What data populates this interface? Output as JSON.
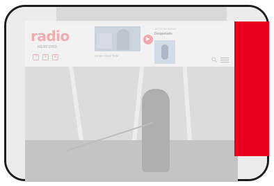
{
  "brand": {
    "logo_text": "radio",
    "logo_sub": "HERFORD"
  },
  "header": {
    "now_playing_label": "JETZT IM RADIO",
    "now_playing_title": "Desperado",
    "caption": "ca ab  Olivat Telte",
    "mini_icons": [
      "?",
      "X",
      "8"
    ]
  },
  "colors": {
    "accent_red": "#e8001c",
    "frame": "#1d1d1d",
    "logo_pink": "#f0a7ad"
  },
  "icons": {
    "search": "search-icon",
    "menu": "menu-icon",
    "play": "play-icon"
  }
}
